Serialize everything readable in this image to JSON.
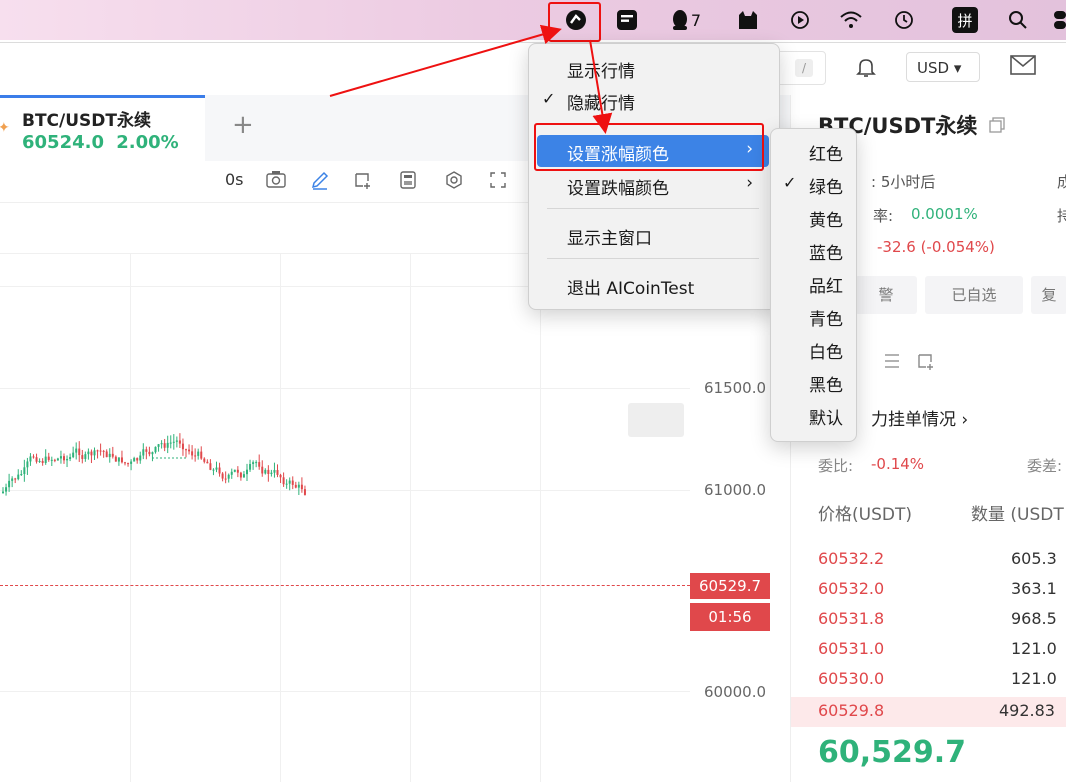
{
  "menubar": {
    "qq_count": "7",
    "ime_label": "拼"
  },
  "toolbar": {
    "search_slash": "/",
    "currency": "USD ▾"
  },
  "tab": {
    "title": "BTC/USDT永续",
    "price": "60524.0",
    "change": "2.00%",
    "add": "+"
  },
  "chart_toolbar": {
    "interval": "0s"
  },
  "chart": {
    "y_labels": [
      "61500.0",
      "61000.0",
      "60000.0"
    ],
    "current_price": "60529.7",
    "countdown": "01:56"
  },
  "popup": {
    "items": [
      {
        "label": "显示行情",
        "checked": ""
      },
      {
        "label": "隐藏行情",
        "checked": "✓"
      },
      {
        "label": "设置涨幅颜色",
        "arrow": "›"
      },
      {
        "label": "设置跌幅颜色",
        "arrow": "›"
      },
      {
        "label": "显示主窗口"
      },
      {
        "label": "退出 AICoinTest"
      }
    ]
  },
  "submenu": {
    "items": [
      {
        "label": "红色",
        "checked": ""
      },
      {
        "label": "绿色",
        "checked": "✓"
      },
      {
        "label": "黄色",
        "checked": ""
      },
      {
        "label": "蓝色",
        "checked": ""
      },
      {
        "label": "品红",
        "checked": ""
      },
      {
        "label": "青色",
        "checked": ""
      },
      {
        "label": "白色",
        "checked": ""
      },
      {
        "label": "黑色",
        "checked": ""
      },
      {
        "label": "默认",
        "checked": ""
      }
    ]
  },
  "right_panel": {
    "title": "BTC/USDT永续",
    "funding_interval": ": 5小时后",
    "right_cut_1": "成",
    "rate_label": "率:",
    "rate_value": "0.0001%",
    "right_cut_2": "持",
    "change_value": "-32.6 (-0.054%)",
    "btn_alert": "警",
    "btn_watch": "已自选",
    "btn_cut": "复",
    "orderbook_link": "力挂单情况 ›",
    "ratio_label": "委比:",
    "ratio_value": "-0.14%",
    "diff_label": "委差:",
    "col_price": "价格(USDT)",
    "col_qty": "数量 (USDT",
    "orderbook": [
      {
        "price": "60532.2",
        "qty": "605.3"
      },
      {
        "price": "60532.0",
        "qty": "363.1"
      },
      {
        "price": "60531.8",
        "qty": "968.5"
      },
      {
        "price": "60531.0",
        "qty": "121.0"
      },
      {
        "price": "60530.0",
        "qty": "121.0"
      }
    ],
    "ob_highlight_price": "60529.8",
    "ob_highlight_qty": "492.83",
    "last_price": "60,529.7"
  },
  "colors": {
    "accent_blue": "#3c83e6",
    "up_green": "#2fb27a",
    "down_red": "#e0484b",
    "annotation_red": "#ee1111"
  }
}
